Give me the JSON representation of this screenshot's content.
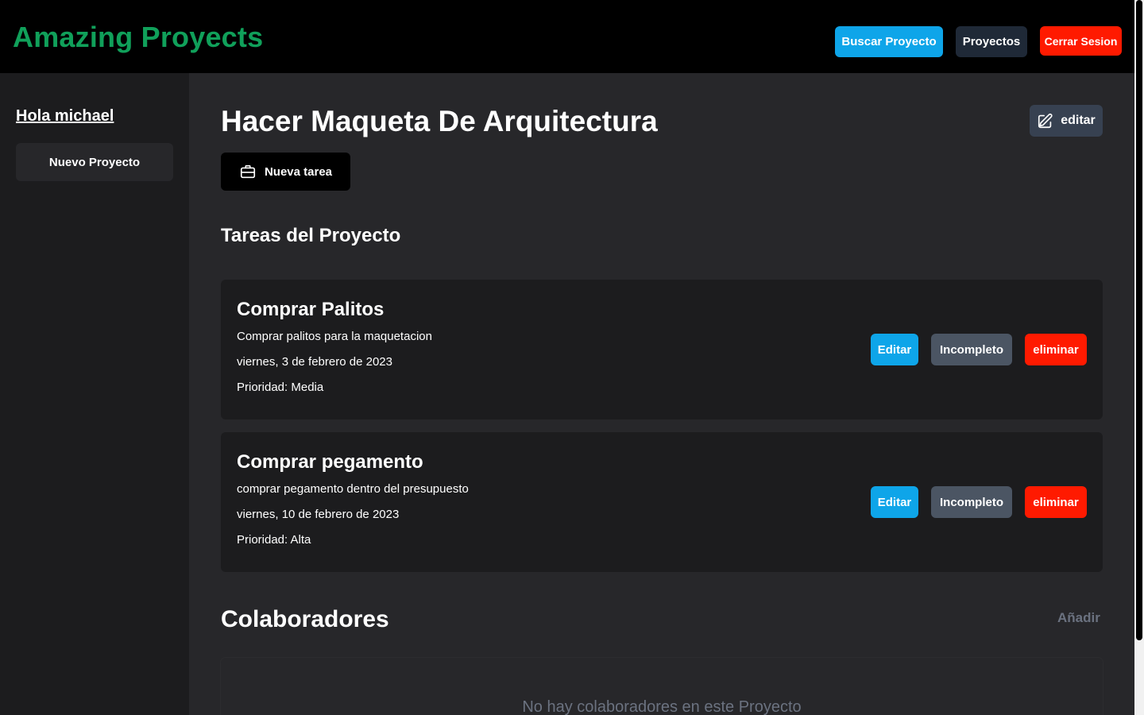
{
  "header": {
    "brand": "Amazing Proyects",
    "buttons": {
      "buscar": "Buscar Proyecto",
      "proyectos": "Proyectos",
      "cerrar": "Cerrar Sesion"
    }
  },
  "sidebar": {
    "greeting": "Hola michael",
    "new_project": "Nuevo Proyecto"
  },
  "project": {
    "title": "Hacer Maqueta De Arquitectura",
    "edit_label": "editar",
    "new_task_label": "Nueva tarea"
  },
  "tasks_section": {
    "title": "Tareas del Proyecto",
    "items": [
      {
        "name": "Comprar Palitos",
        "description": "Comprar palitos para la maquetacion",
        "date": "viernes, 3 de febrero de 2023",
        "priority": "Prioridad: Media",
        "edit": "Editar",
        "status": "Incompleto",
        "delete": "eliminar"
      },
      {
        "name": "Comprar pegamento",
        "description": "comprar pegamento dentro del presupuesto",
        "date": "viernes, 10 de febrero de 2023",
        "priority": "Prioridad: Alta",
        "edit": "Editar",
        "status": "Incompleto",
        "delete": "eliminar"
      }
    ]
  },
  "collaborators": {
    "title": "Colaboradores",
    "add_label": "Añadir",
    "empty_message": "No hay colaboradores en este Proyecto"
  },
  "colors": {
    "brand": "#10a05a",
    "primary": "#0ea5e9",
    "danger": "#ff1a00",
    "neutral": "#4b5563"
  },
  "icons": [
    "edit-icon",
    "briefcase-icon"
  ]
}
